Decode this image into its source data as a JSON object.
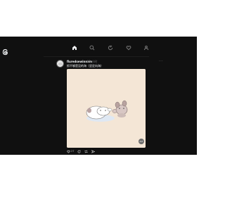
{
  "app": {
    "name": "Threads"
  },
  "nav": {
    "items": [
      {
        "icon": "home-icon",
        "active": true
      },
      {
        "icon": "search-icon",
        "active": false
      },
      {
        "icon": "create-icon",
        "active": false
      },
      {
        "icon": "heart-icon",
        "active": false
      },
      {
        "icon": "profile-icon",
        "active": false
      }
    ]
  },
  "post": {
    "username": "fluredsewinnam",
    "timestamp": "11 小时",
    "text": "抓不够是没的海（坚定向海）",
    "more_label": "...",
    "image_alt": "ALT",
    "likes": "27"
  },
  "colors": {
    "background": "#101010",
    "text_primary": "#f3f5f7",
    "text_secondary": "#777777",
    "media_bg": "#f4e6d6"
  }
}
